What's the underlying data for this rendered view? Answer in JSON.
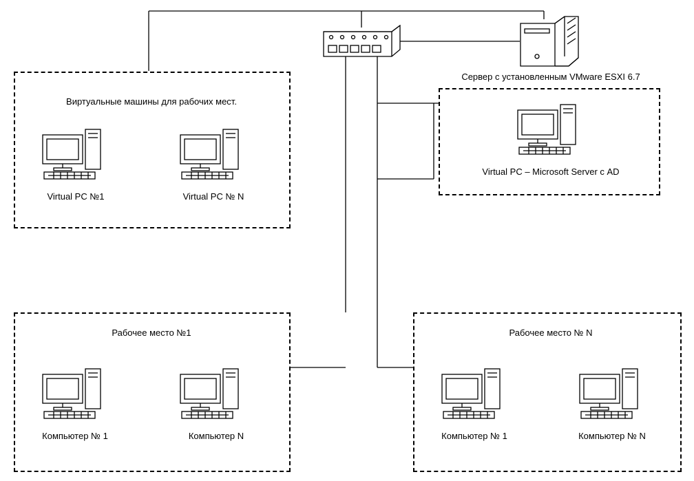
{
  "labels": {
    "server": "Сервер с установленным VMware ESXI 6.7",
    "vm_box_title": "Виртуальные машины для рабочих мест.",
    "vpc1": "Virtual PC №1",
    "vpcN": "Virtual PC № N",
    "ad_server": "Virtual PC – Microsoft Server с AD",
    "ws1_title": "Рабочее место №1",
    "ws1_pc1": "Компьютер № 1",
    "ws1_pcN": "Компьютер N",
    "wsN_title": "Рабочее место № N",
    "wsN_pc1": "Компьютер № 1",
    "wsN_pcN": "Компьютер № N"
  }
}
